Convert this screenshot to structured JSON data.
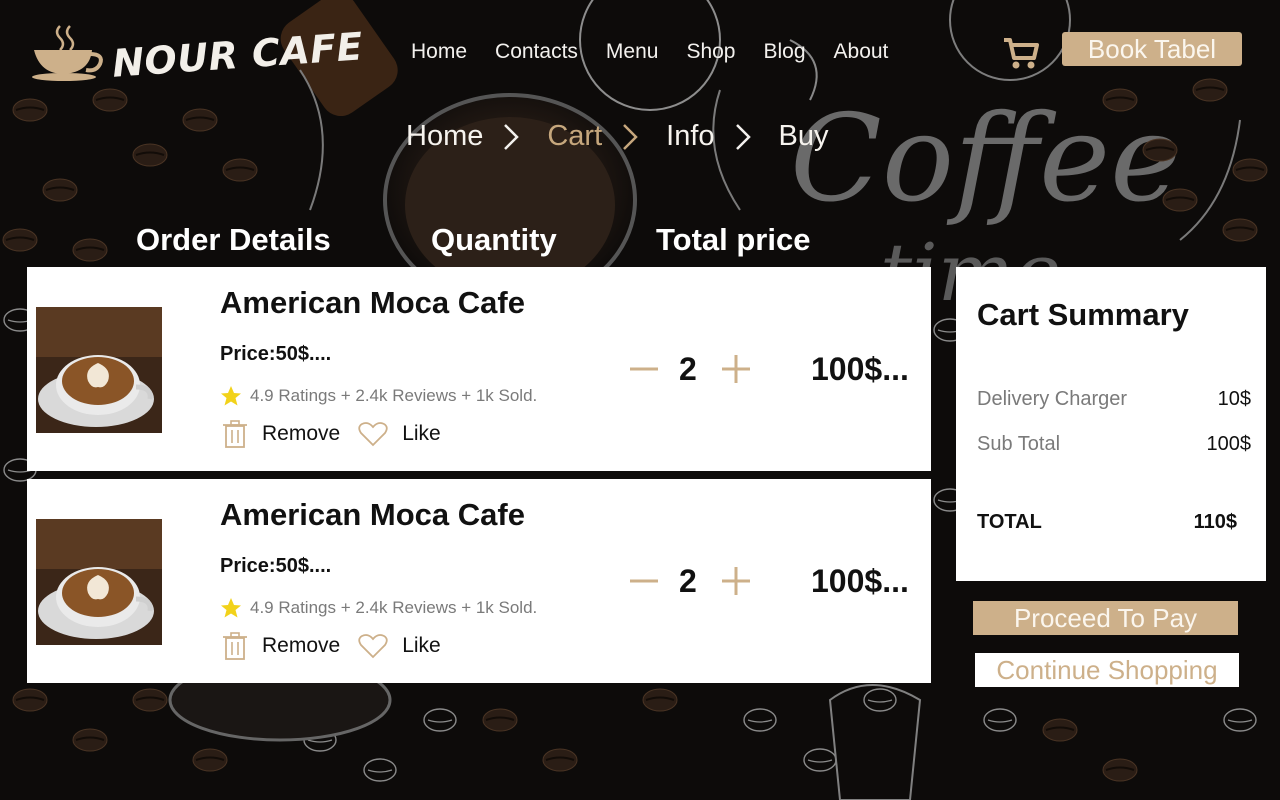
{
  "brand": {
    "name": "NOUR CAFE"
  },
  "nav": [
    "Home",
    "Contacts",
    "Menu",
    "Shop",
    "Blog",
    "About"
  ],
  "header": {
    "book_label": "Book Tabel"
  },
  "breadcrumb": [
    "Home",
    "Cart",
    "Info",
    "Buy"
  ],
  "columns": {
    "details": "Order Details",
    "quantity": "Quantity",
    "total": "Total price"
  },
  "items": [
    {
      "name": "American Moca Cafe",
      "price": "Price:50$....",
      "rating": "4.9 Ratings + 2.4k Reviews + 1k Sold.",
      "remove": "Remove",
      "like": "Like",
      "quantity": "2",
      "total": "100$..."
    },
    {
      "name": "American Moca Cafe",
      "price": "Price:50$....",
      "rating": "4.9 Ratings + 2.4k Reviews + 1k Sold.",
      "remove": "Remove",
      "like": "Like",
      "quantity": "2",
      "total": "100$..."
    }
  ],
  "summary": {
    "title": "Cart Summary",
    "delivery_label": "Delivery Charger",
    "delivery_value": "10$",
    "subtotal_label": "Sub Total",
    "subtotal_value": "100$",
    "total_label": "TOTAL",
    "total_value": "110$"
  },
  "buttons": {
    "pay": "Proceed To Pay",
    "continue": "Continue Shopping"
  },
  "colors": {
    "accent": "#cdb08a",
    "accent_text": "#c6a77d",
    "background": "#0d0b0a",
    "card": "#ffffff"
  }
}
